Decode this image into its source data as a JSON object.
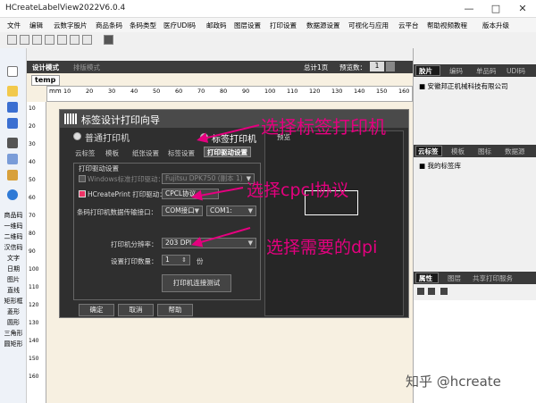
{
  "window": {
    "title": "HCreateLabelView2022V6.0.4"
  },
  "menu": [
    "文件",
    "编辑",
    "云数字股片",
    "商品条码",
    "条码类型",
    "医疗UDI码",
    "邮政码",
    "图层设置",
    "打印设置",
    "数据源设置",
    "可视化与应用",
    "云平台",
    "帮助视频教程",
    "版本升级"
  ],
  "center_header": {
    "design_mode": "设计模式",
    "view_mode": "排版模式",
    "page_count": "总计1页",
    "preview_count": "预览数：",
    "preview_value": "1"
  },
  "doc_tab": "temp",
  "ruler_unit": "mm",
  "ruler_ticks": [
    "10",
    "20",
    "30",
    "40",
    "50",
    "60",
    "70",
    "80",
    "90",
    "100",
    "110",
    "120",
    "130",
    "140",
    "150",
    "160"
  ],
  "vruler_ticks": [
    "10",
    "20",
    "30",
    "40",
    "50",
    "60",
    "70",
    "80",
    "90",
    "100",
    "110",
    "120",
    "130",
    "140",
    "150",
    "160"
  ],
  "left_tools": [
    "商品码",
    "一维码",
    "二维码",
    "汉信码",
    "文字",
    "日期",
    "图片",
    "直线",
    "矩形框",
    "菱形",
    "圆形",
    "三角形",
    "圆矩形"
  ],
  "right_panel": {
    "top_tabs": [
      "胶片",
      "编码",
      "单品码",
      "UDI码"
    ],
    "company": "安徽邦正机械科技有限公司",
    "mid_tabs": [
      "云标签",
      "模板",
      "图标",
      "数据源"
    ],
    "my_library": "我的标签库",
    "bottom_tabs": [
      "属性",
      "图层",
      "共享打印服务"
    ]
  },
  "dialog": {
    "title": "标签设计打印向导",
    "radio_normal": "普通打印机",
    "radio_label": "标签打印机",
    "preview_label": "预览",
    "tabs": [
      "云标签",
      "模板",
      "纸张设置",
      "标签设置",
      "打印驱动设置"
    ],
    "group_title": "打印驱动设置",
    "windows_driver_label": "Windows标准打印驱动：",
    "windows_driver_value": "Fujitsu DPK750 (副本 1)",
    "hcreate_driver_label": "HCreatePrint 打印驱动：",
    "hcreate_driver_value": "CPCL协议",
    "port_label": "条码打印机数据传输接口：",
    "port_type": "COM接口",
    "port_value": "COM1:",
    "dpi_label": "打印机分辨率：",
    "dpi_value": "203 DPI",
    "count_label": "设置打印数量：",
    "count_value": "1",
    "count_unit": "份",
    "test_button": "打印机连接测试",
    "ok": "确定",
    "cancel": "取消",
    "help": "帮助"
  },
  "annotations": {
    "a1": "选择标签打印机",
    "a2": "选择cpcl协议",
    "a3": "选择需要的dpi"
  },
  "watermark": "知乎 @hcreate",
  "colors": {
    "annotation": "#e4007f",
    "dark_panel": "#2f2f2f",
    "canvas": "#f7f0e1"
  }
}
